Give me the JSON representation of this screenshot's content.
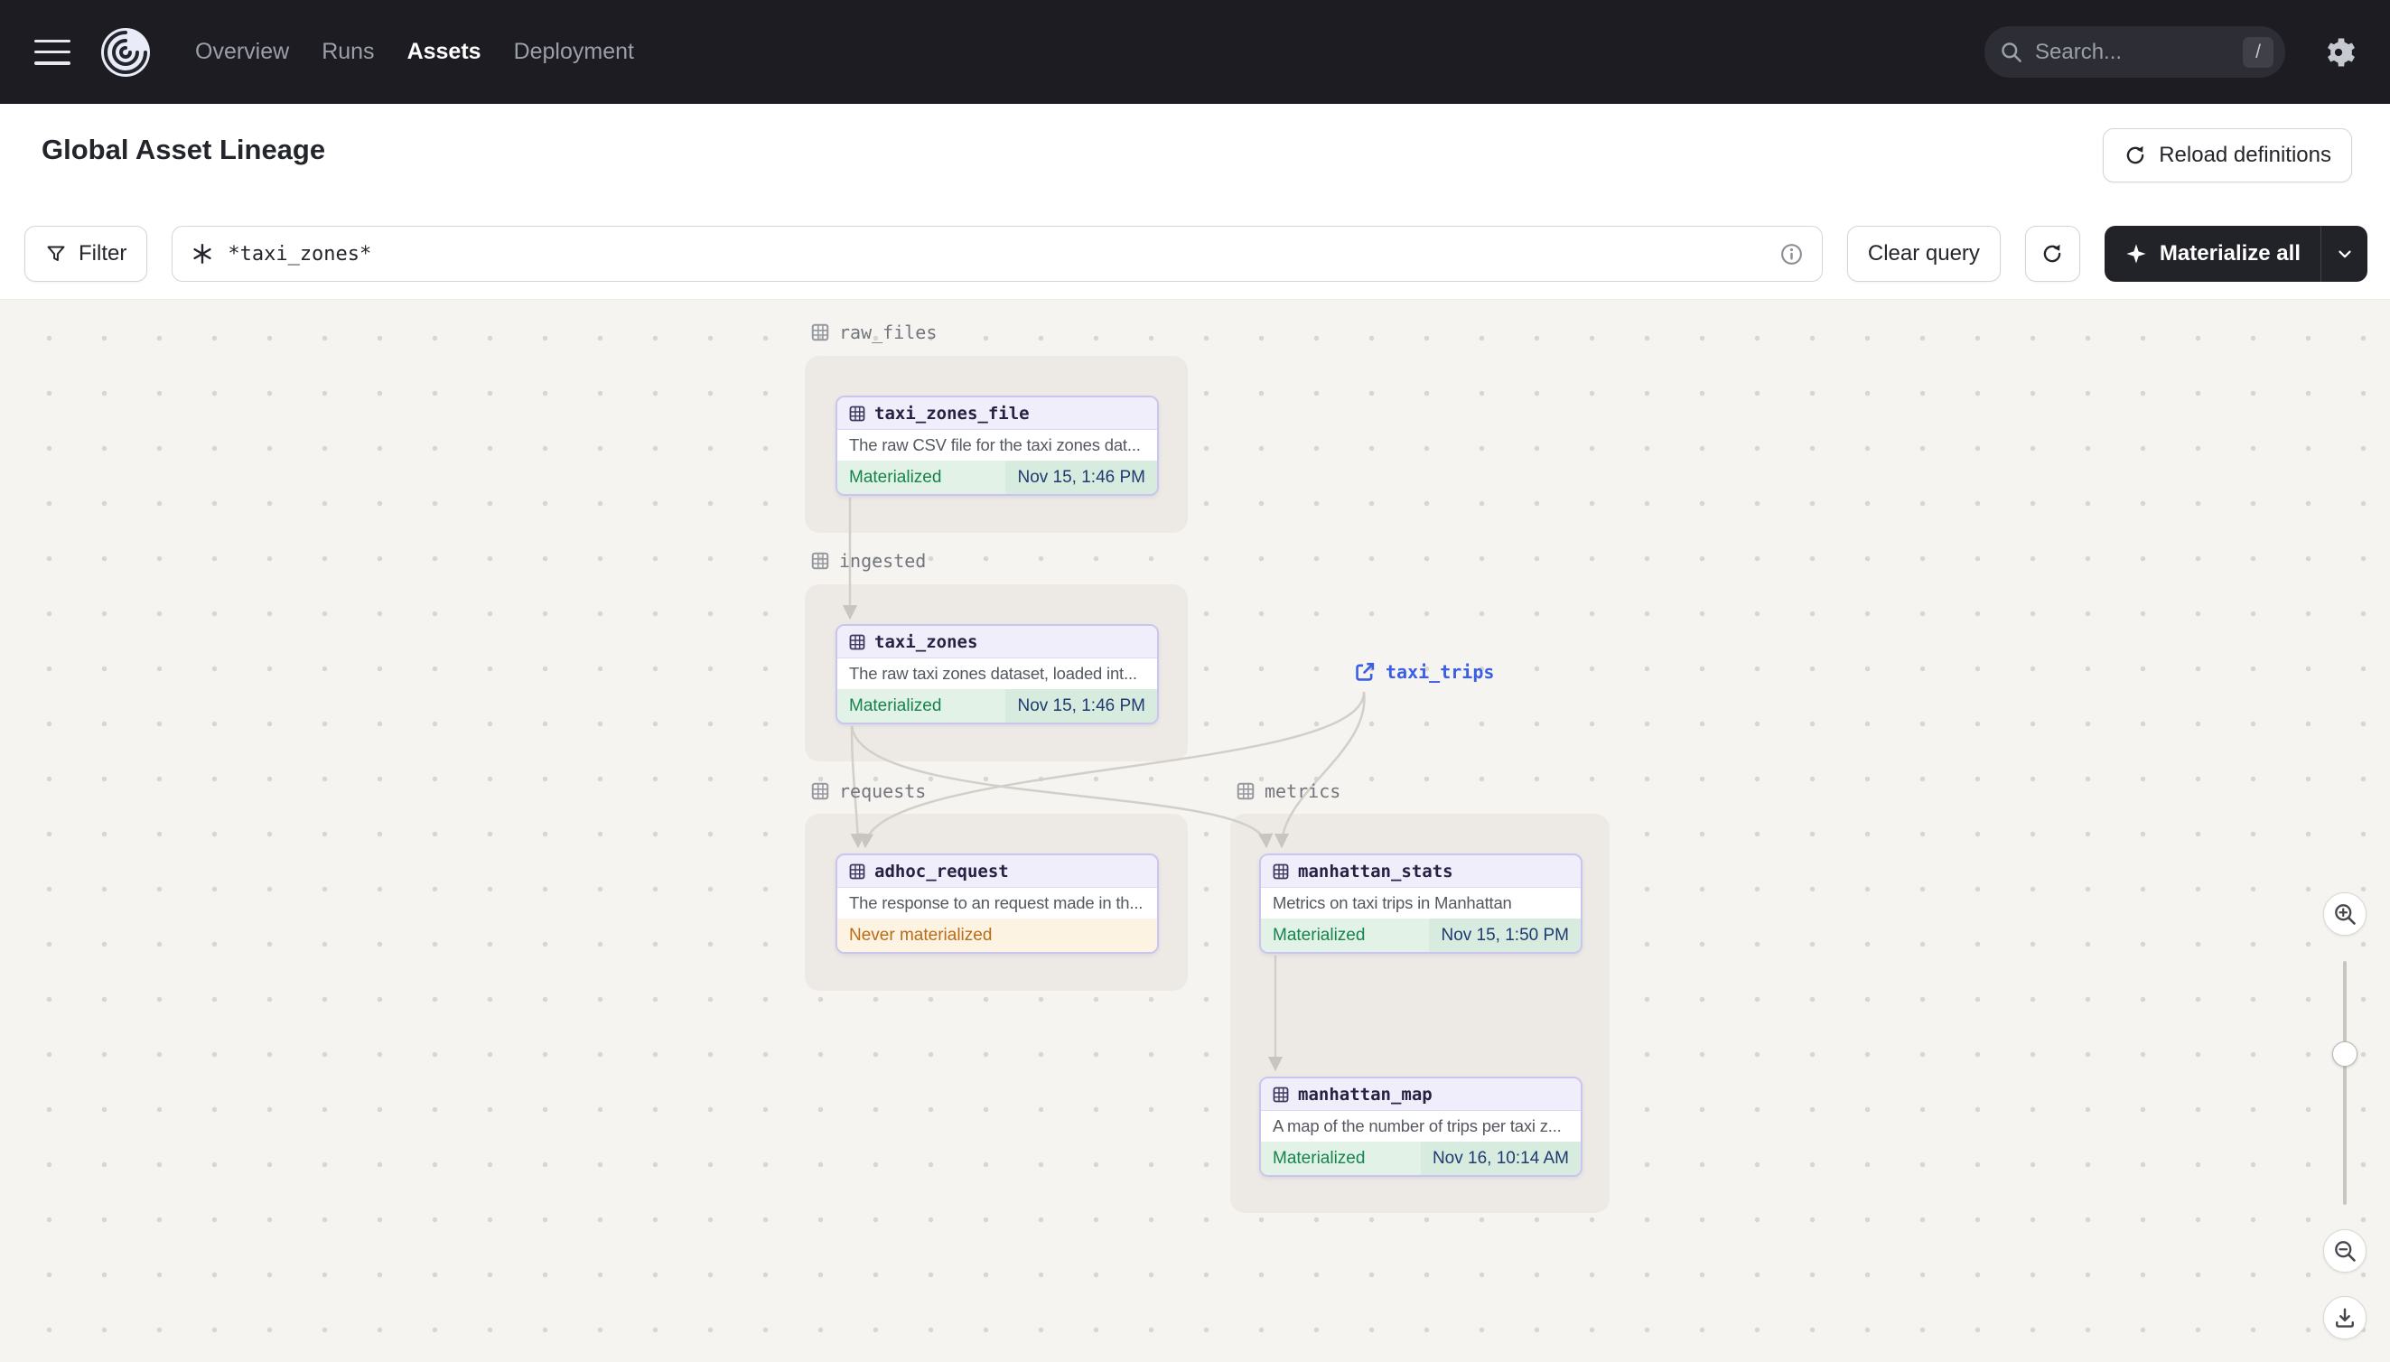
{
  "colors": {
    "navbar_bg": "#1c1c22",
    "node_border_purple": "#c9c5ee",
    "node_header_lavender": "#f1eefb",
    "materialized_green": "#15834e",
    "materialized_bg": "#e3f2e7",
    "never_materialized_orange": "#bb6b15",
    "never_materialized_bg": "#fcf3e2",
    "timestamp_navy": "#1f3a71",
    "external_link_blue": "#3a5ee5",
    "canvas_bg": "#f6f4f1"
  },
  "navbar": {
    "links": [
      {
        "label": "Overview",
        "active": false
      },
      {
        "label": "Runs",
        "active": false
      },
      {
        "label": "Assets",
        "active": true
      },
      {
        "label": "Deployment",
        "active": false
      }
    ],
    "search": {
      "placeholder": "Search...",
      "shortcut": "/"
    }
  },
  "header": {
    "title": "Global Asset Lineage",
    "reload_button_label": "Reload definitions"
  },
  "toolbar": {
    "filter_label": "Filter",
    "query_value": "*taxi_zones*",
    "clear_query_label": "Clear query",
    "materialize_label": "Materialize all"
  },
  "graph": {
    "groups": [
      {
        "name": "raw_files"
      },
      {
        "name": "ingested"
      },
      {
        "name": "requests"
      },
      {
        "name": "metrics"
      }
    ],
    "nodes": [
      {
        "name": "taxi_zones_file",
        "group": "raw_files",
        "description": "The raw CSV file for the taxi zones dat...",
        "status": "Materialized",
        "timestamp": "Nov 15, 1:46 PM"
      },
      {
        "name": "taxi_zones",
        "group": "ingested",
        "description": "The raw taxi zones dataset, loaded int...",
        "status": "Materialized",
        "timestamp": "Nov 15, 1:46 PM"
      },
      {
        "name": "adhoc_request",
        "group": "requests",
        "description": "The response to an request made in th...",
        "status": "Never materialized",
        "timestamp": ""
      },
      {
        "name": "manhattan_stats",
        "group": "metrics",
        "description": "Metrics on taxi trips in Manhattan",
        "status": "Materialized",
        "timestamp": "Nov 15, 1:50 PM"
      },
      {
        "name": "manhattan_map",
        "group": "metrics",
        "description": "A map of the number of trips per taxi z...",
        "status": "Materialized",
        "timestamp": "Nov 16, 10:14 AM"
      }
    ],
    "external_nodes": [
      {
        "name": "taxi_trips"
      }
    ],
    "edges": [
      {
        "from": "taxi_zones_file",
        "to": "taxi_zones"
      },
      {
        "from": "taxi_zones",
        "to": "adhoc_request"
      },
      {
        "from": "taxi_zones",
        "to": "manhattan_stats"
      },
      {
        "from": "taxi_trips",
        "to": "adhoc_request"
      },
      {
        "from": "taxi_trips",
        "to": "manhattan_stats"
      },
      {
        "from": "manhattan_stats",
        "to": "manhattan_map"
      }
    ]
  }
}
